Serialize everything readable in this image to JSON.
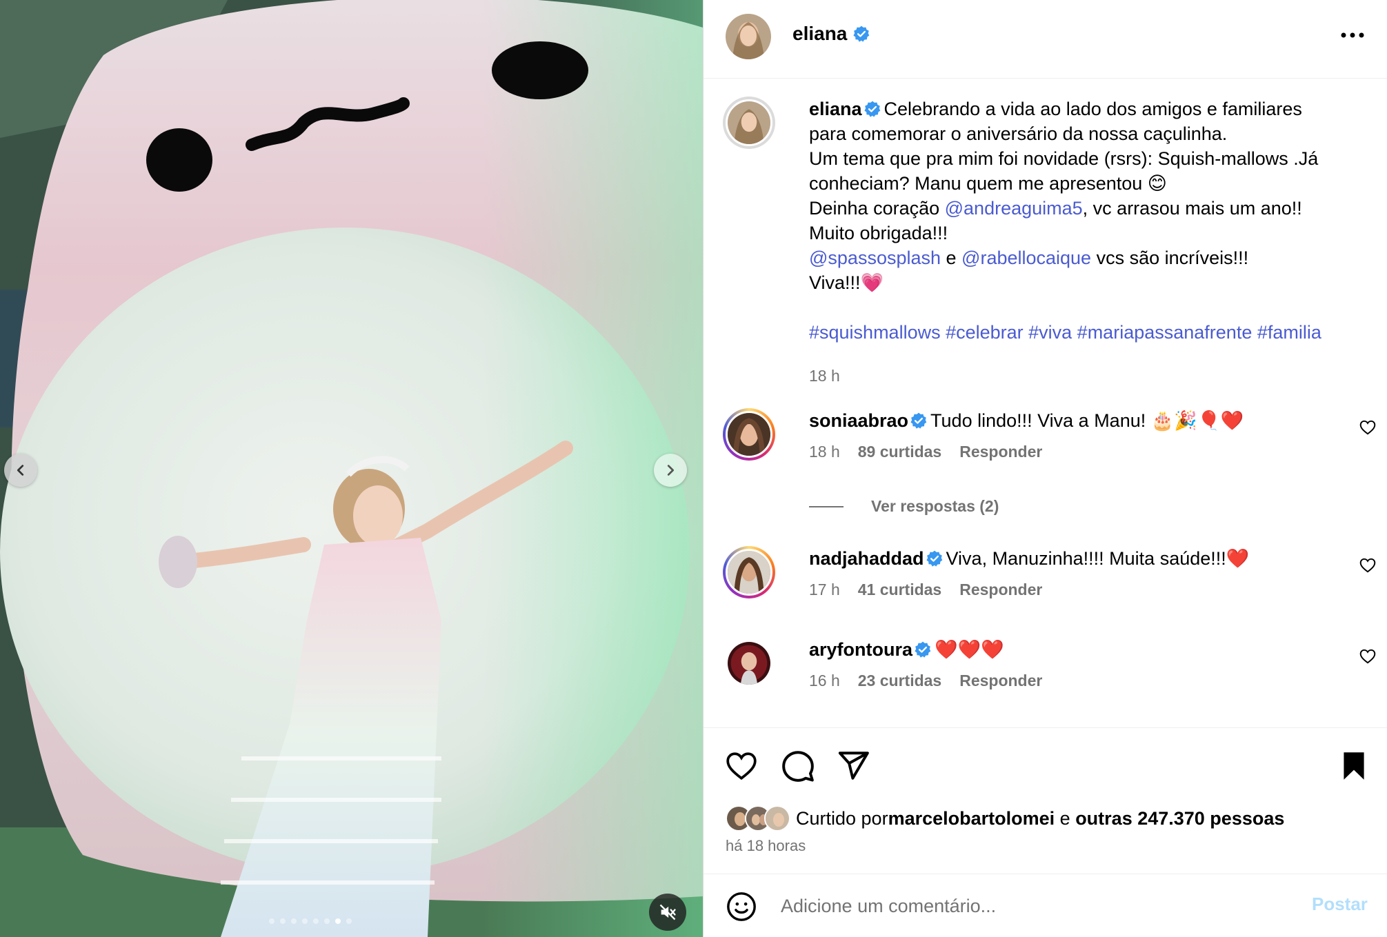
{
  "header": {
    "username": "eliana"
  },
  "caption": {
    "username": "eliana",
    "line1": "Celebrando a vida ao lado dos amigos e familiares",
    "line2": "para comemorar o aniversário da nossa caçulinha.",
    "line3": "Um tema que pra mim foi novidade (rsrs): Squish-mallows .Já",
    "line4": "conheciam? Manu quem me apresentou 😊",
    "line5_prefix": "Deinha coração ",
    "line5_mention": "@andreaguima5",
    "line5_suffix": ", vc arrasou mais um ano!!",
    "line6": "Muito obrigada!!!",
    "line7_mention1": "@spassosplash",
    "line7_and": " e ",
    "line7_mention2": "@rabellocaique",
    "line7_suffix": " vcs são incríveis!!!",
    "line8": "Viva!!!💗",
    "hashtags": "#squishmallows #celebrar #viva #mariapassanafrente #familia",
    "time": "18 h"
  },
  "comments": [
    {
      "username": "soniaabrao",
      "text": "Tudo lindo!!! Viva a Manu! 🎂🎉🎈❤️",
      "time": "18 h",
      "likes": "89 curtidas",
      "reply": "Responder"
    },
    {
      "username": "nadjahaddad",
      "text": "Viva, Manuzinha!!!! Muita saúde!!!❤️",
      "time": "17 h",
      "likes": "41 curtidas",
      "reply": "Responder"
    },
    {
      "username": "aryfontoura",
      "text": "❤️❤️❤️",
      "time": "16 h",
      "likes": "23 curtidas",
      "reply": "Responder"
    }
  ],
  "view_replies": "Ver respostas (2)",
  "likes": {
    "prefix": "Curtido por ",
    "user": "marcelobartolomei",
    "middle": " e ",
    "others": "outras 247.370 pessoas"
  },
  "time_ago": "há 18 horas",
  "comment_input": {
    "placeholder": "Adicione um comentário...",
    "value": ""
  },
  "post_button": "Postar",
  "carousel": {
    "total": 8,
    "current": 7
  },
  "colors": {
    "link": "#4a5bd0",
    "verified": "#3897f0",
    "muted": "#737373",
    "post_button": "#b2dffc"
  }
}
